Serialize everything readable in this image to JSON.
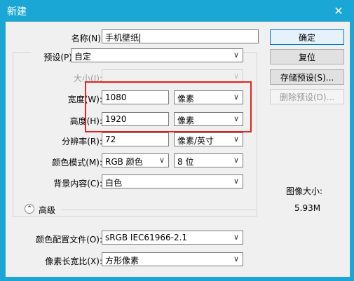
{
  "window": {
    "title": "新建"
  },
  "fields": {
    "name_label": "名称(N):",
    "name_value": "手机壁纸",
    "preset_label": "预设(P):",
    "preset_value": "自定",
    "size_label": "大小(I):",
    "size_value": "",
    "width_label": "宽度(W):",
    "width_value": "1080",
    "width_unit": "像素",
    "height_label": "高度(H):",
    "height_value": "1920",
    "height_unit": "像素",
    "resolution_label": "分辨率(R):",
    "resolution_value": "72",
    "resolution_unit": "像素/英寸",
    "color_mode_label": "颜色模式(M):",
    "color_mode_value": "RGB 颜色",
    "bit_depth_value": "8 位",
    "background_label": "背景内容(C):",
    "background_value": "白色",
    "advanced_label": "高级",
    "color_profile_label": "颜色配置文件(O):",
    "color_profile_value": "sRGB IEC61966-2.1",
    "pixel_aspect_label": "像素长宽比(X):",
    "pixel_aspect_value": "方形像素"
  },
  "buttons": {
    "ok": "确定",
    "reset": "复位",
    "save_preset": "存储预设(S)...",
    "delete_preset": "删除预设(D)..."
  },
  "info": {
    "image_size_label": "图像大小:",
    "image_size_value": "5.93M"
  },
  "colors": {
    "title_bar": "#1aa7d6",
    "highlight_box": "#e2261f"
  }
}
